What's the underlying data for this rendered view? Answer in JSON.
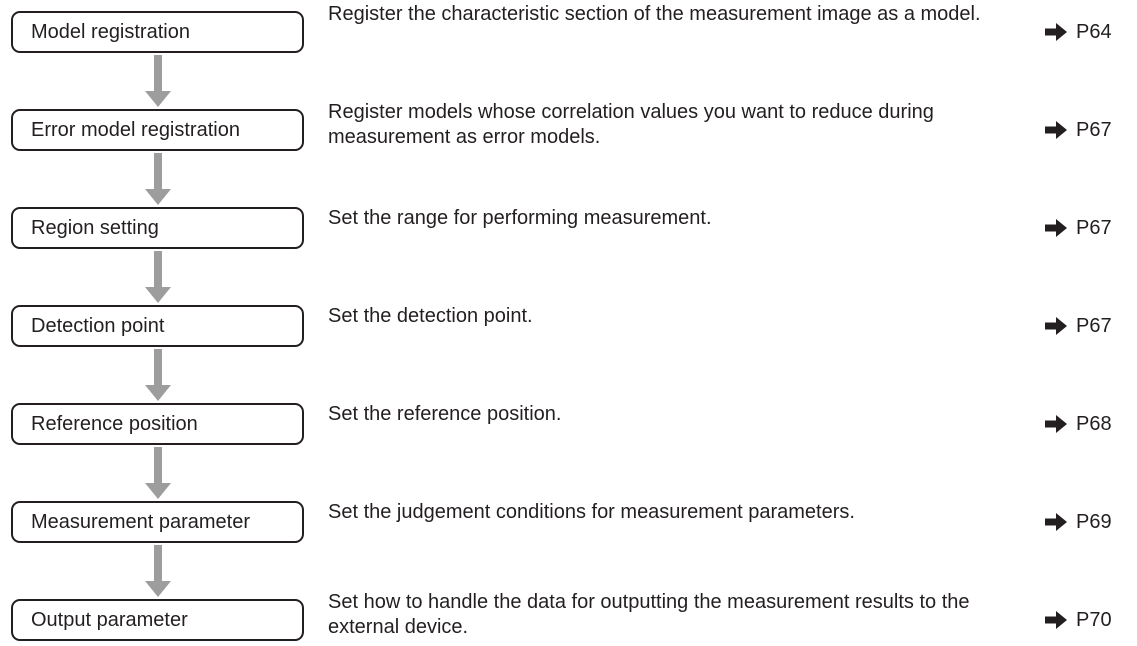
{
  "steps": [
    {
      "label": "Model registration",
      "description": "Register the characteristic section of the measurement image as a model.",
      "page_ref": "P64"
    },
    {
      "label": "Error model registration",
      "description": "Register models whose correlation values you want to reduce during measurement as error models.",
      "page_ref": "P67"
    },
    {
      "label": "Region setting",
      "description": "Set the range for performing measurement.",
      "page_ref": "P67"
    },
    {
      "label": "Detection point",
      "description": "Set the detection point.",
      "page_ref": "P67"
    },
    {
      "label": "Reference position",
      "description": "Set the reference position.",
      "page_ref": "P68"
    },
    {
      "label": "Measurement parameter",
      "description": "Set the judgement conditions for measurement parameters.",
      "page_ref": "P69"
    },
    {
      "label": "Output parameter",
      "description": "Set how to handle the data for outputting the measurement results to the external device.",
      "page_ref": "P70"
    }
  ],
  "icons": {
    "reference_arrow": "right-arrow-icon",
    "flow_arrow": "down-arrow-icon"
  },
  "colors": {
    "text": "#231f20",
    "box_border": "#231f20",
    "flow_arrow": "#9d9d9d",
    "reference_arrow": "#231f20"
  }
}
